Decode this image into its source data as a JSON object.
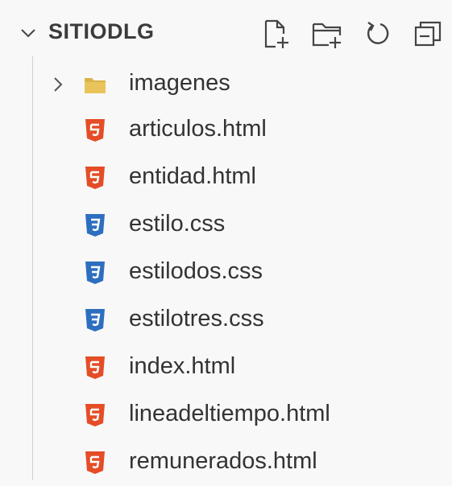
{
  "explorer": {
    "title": "SITIODLG",
    "actions": [
      {
        "name": "new-file-icon"
      },
      {
        "name": "new-folder-icon"
      },
      {
        "name": "refresh-icon"
      },
      {
        "name": "collapse-all-icon"
      }
    ]
  },
  "colors": {
    "html": "#e44d26",
    "css": "#2d6fbf",
    "folder": "#d9b44a",
    "text": "#333333",
    "background": "#f8f8f8"
  },
  "tree": {
    "items": [
      {
        "label": "imagenes",
        "kind": "folder",
        "icon": "folder-icon"
      },
      {
        "label": "articulos.html",
        "kind": "html",
        "icon": "html5-icon"
      },
      {
        "label": "entidad.html",
        "kind": "html",
        "icon": "html5-icon"
      },
      {
        "label": "estilo.css",
        "kind": "css",
        "icon": "css3-icon"
      },
      {
        "label": "estilodos.css",
        "kind": "css",
        "icon": "css3-icon"
      },
      {
        "label": "estilotres.css",
        "kind": "css",
        "icon": "css3-icon"
      },
      {
        "label": "index.html",
        "kind": "html",
        "icon": "html5-icon"
      },
      {
        "label": "lineadeltiempo.html",
        "kind": "html",
        "icon": "html5-icon"
      },
      {
        "label": "remunerados.html",
        "kind": "html",
        "icon": "html5-icon"
      }
    ]
  }
}
